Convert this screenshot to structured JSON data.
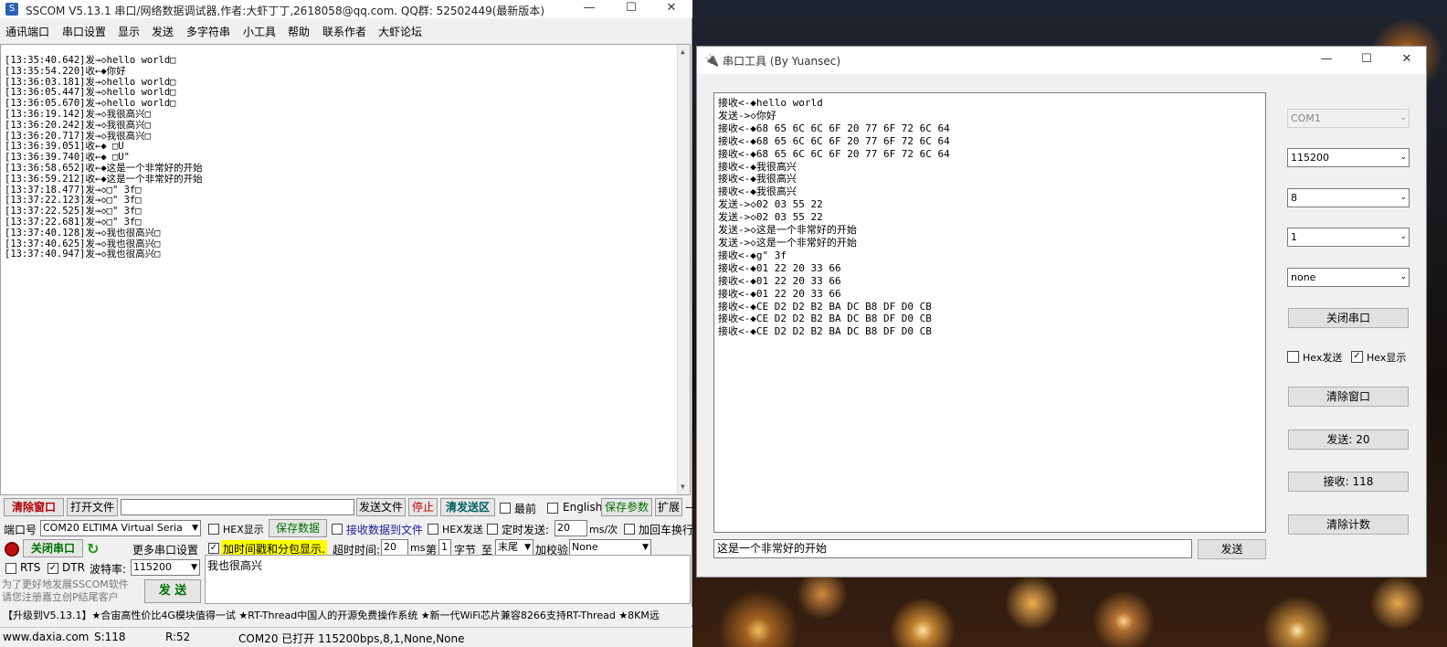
{
  "sscom": {
    "title": "SSCOM V5.13.1 串口/网络数据调试器,作者:大虾丁丁,2618058@qq.com. QQ群: 52502449(最新版本)",
    "menu": [
      "通讯端口",
      "串口设置",
      "显示",
      "发送",
      "多字符串",
      "小工具",
      "帮助",
      "联系作者",
      "大虾论坛"
    ],
    "log": [
      "[13:35:40.642]发→◇hello world□",
      "[13:35:54.220]收←◆你好",
      "[13:36:03.181]发→◇hello world□",
      "[13:36:05.447]发→◇hello world□",
      "[13:36:05.670]发→◇hello world□",
      "[13:36:19.142]发→◇我很高兴□",
      "[13:36:20.242]发→◇我很高兴□",
      "[13:36:20.717]发→◇我很高兴□",
      "[13:36:39.051]收←◆ □U",
      "[13:36:39.740]收←◆ □U\"",
      "[13:36:58.652]收←◆这是一个非常好的开始",
      "[13:36:59.212]收←◆这是一个非常好的开始",
      "[13:37:18.477]发→◇□\" 3f□",
      "[13:37:22.123]发→◇□\" 3f□",
      "[13:37:22.525]发→◇□\" 3f□",
      "[13:37:22.681]发→◇□\" 3f□",
      "[13:37:40.128]发→◇我也很高兴□",
      "[13:37:40.625]发→◇我也很高兴□",
      "[13:37:40.947]发→◇我也很高兴□"
    ],
    "row1": {
      "clear": "清除窗口",
      "open_file": "打开文件",
      "send_file": "发送文件",
      "stop": "停止",
      "clear_send": "清发送区",
      "latest": "最前",
      "english": "English",
      "save_params": "保存参数",
      "expand": "扩展",
      "dash": "—"
    },
    "row2": {
      "port_label": "端口号",
      "port_value": "COM20 ELTIMA Virtual Seria",
      "hex_display": "HEX显示",
      "save_data": "保存数据",
      "recv_to_file": "接收数据到文件",
      "hex_send": "HEX发送",
      "timed_send": "定时发送:",
      "interval": "20",
      "interval_unit": "ms/次",
      "add_crlf": "加回车换行"
    },
    "row3": {
      "close_port": "关闭串口",
      "more_settings": "更多串口设置",
      "add_timestamp": "加时间戳和分包显示.",
      "timeout_label": "超时时间:",
      "timeout": "20",
      "ms": "ms",
      "di": "第",
      "byte_no": "1",
      "byte": "字节",
      "to": "至",
      "end": "末尾",
      "checksum_label": "加校验",
      "checksum": "None"
    },
    "row4": {
      "rts": "RTS",
      "dtr": "DTR",
      "baud_label": "波特率:",
      "baud": "115200"
    },
    "send_text": "我也很高兴",
    "promo": [
      "为了更好地发展SSCOM软件",
      "请您注册嘉立创P结尾客户"
    ],
    "send_button": "发 送",
    "ticker": "【升级到V5.13.1】★合宙高性价比4G模块值得一试 ★RT-Thread中国人的开源免费操作系统 ★新一代WiFi芯片兼容8266支持RT-Thread ★8KM远",
    "status": {
      "site": "www.daxia.com",
      "s": "S:118",
      "r": "R:52",
      "port": "COM20 已打开  115200bps,8,1,None,None"
    }
  },
  "tool": {
    "title": "串口工具  (By Yuansec)",
    "recv": [
      "接收<-◆hello world",
      "发送->◇你好",
      "接收<-◆68 65 6C 6C 6F 20 77 6F 72 6C 64",
      "接收<-◆68 65 6C 6C 6F 20 77 6F 72 6C 64",
      "接收<-◆68 65 6C 6C 6F 20 77 6F 72 6C 64",
      "接收<-◆我很高兴",
      "接收<-◆我很高兴",
      "接收<-◆我很高兴",
      "发送->◇02 03 55 22",
      "发送->◇02 03 55 22",
      "发送->◇这是一个非常好的开始",
      "发送->◇这是一个非常好的开始",
      "接收<-◆g\" 3f",
      "接收<-◆01 22 20 33 66",
      "接收<-◆01 22 20 33 66",
      "接收<-◆01 22 20 33 66",
      "接收<-◆CE D2 D2 B2 BA DC B8 DF D0 CB",
      "接收<-◆CE D2 D2 B2 BA DC B8 DF D0 CB",
      "接收<-◆CE D2 D2 B2 BA DC B8 DF D0 CB"
    ],
    "send_input": "这是一个非常好的开始",
    "send_button": "发送",
    "port": "COM1",
    "baud": "115200",
    "databits": "8",
    "stopbits": "1",
    "parity": "none",
    "close_port": "关闭串口",
    "hex_send": "Hex发送",
    "hex_display": "Hex显示",
    "clear_window": "清除窗口",
    "sent": "发送: 20",
    "received": "接收: 118",
    "clear_count": "清除计数"
  }
}
